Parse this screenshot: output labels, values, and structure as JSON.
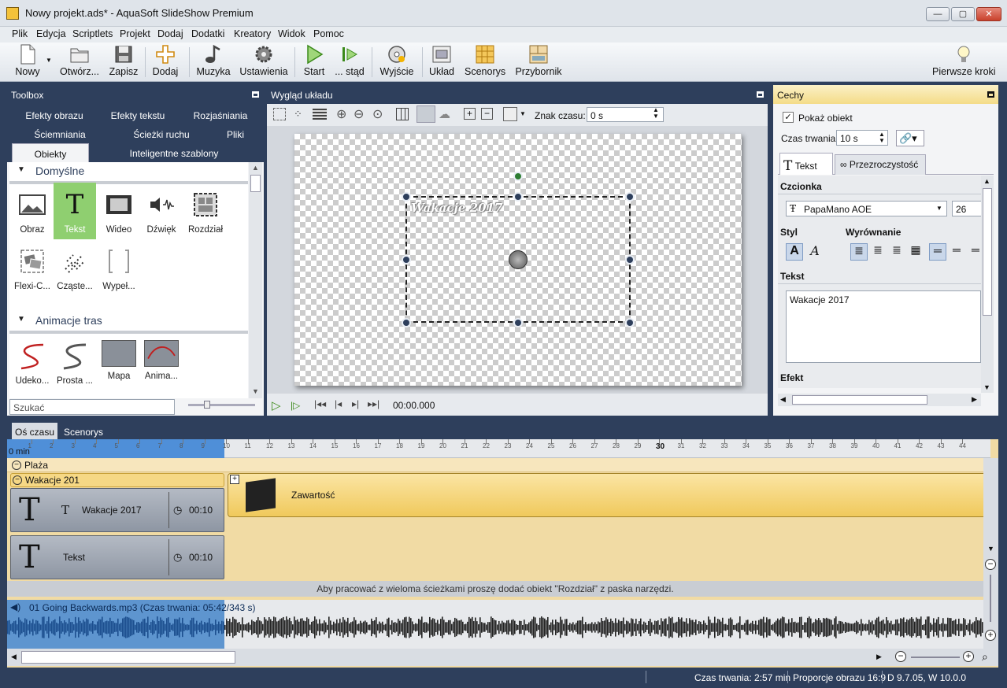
{
  "window": {
    "title": "Nowy projekt.ads* - AquaSoft SlideShow Premium",
    "min": "—",
    "max": "▢",
    "close": "✕"
  },
  "menu": [
    "Plik",
    "Edycja",
    "Scriptlets",
    "Projekt",
    "Dodaj",
    "Dodatki",
    "Kreatory",
    "Widok",
    "Pomoc"
  ],
  "toolbar": {
    "nowy": "Nowy",
    "otworz": "Otwórz...",
    "zapisz": "Zapisz",
    "dodaj": "Dodaj",
    "muzyka": "Muzyka",
    "ustawienia": "Ustawienia",
    "start": "Start",
    "stad": "... stąd",
    "wyjscie": "Wyjście",
    "uklad": "Układ",
    "scenorys": "Scenorys",
    "przybornik": "Przybornik",
    "pierwsze_kroki": "Pierwsze kroki"
  },
  "toolbox": {
    "title": "Toolbox",
    "tabs_row1": [
      "Efekty obrazu",
      "Efekty tekstu",
      "Rozjaśniania"
    ],
    "tabs_row2": [
      "Ściemniania",
      "Ścieżki ruchu",
      "Pliki"
    ],
    "tabs_row3": [
      "Obiekty",
      "Inteligentne szablony"
    ],
    "section_default": "Domyślne",
    "items_default": [
      "Obraz",
      "Tekst",
      "Wideo",
      "Dźwięk",
      "Rozdział",
      "Flexi-C...",
      "Cząste...",
      "Wypeł..."
    ],
    "section_anim": "Animacje tras",
    "items_anim": [
      "Udeko...",
      "Prosta ...",
      "Mapa",
      "Anima..."
    ],
    "search_placeholder": "Szukać",
    "search_value": "Szukać"
  },
  "layout": {
    "title": "Wygląd układu",
    "znak_czasu_label": "Znak czasu:",
    "znak_czasu_value": "0 s",
    "canvas_text": "Wakacje 2017",
    "playback_time": "00:00.000"
  },
  "props": {
    "title": "Cechy",
    "show_object": "Pokaż obiekt",
    "duration_label": "Czas trwania:",
    "duration_value": "10 s",
    "tab_text": "Tekst",
    "tab_transparency": "Przezroczystość",
    "font_section": "Czcionka",
    "font_name": "PapaMano AOE",
    "font_size": "26",
    "style_label": "Styl",
    "align_label": "Wyrównanie",
    "text_label": "Tekst",
    "text_value": "Wakacje 2017",
    "effect_label": "Efekt"
  },
  "bottom_tabs": [
    "Oś czasu",
    "Scenorys"
  ],
  "timeline": {
    "ruler_start": "0 min",
    "ruler_ticks": [
      "1",
      "2",
      "3",
      "4",
      "5",
      "6",
      "7",
      "8",
      "9",
      "10",
      "11",
      "12",
      "13",
      "14",
      "15",
      "16",
      "17",
      "18",
      "19",
      "20",
      "21",
      "22",
      "23",
      "24",
      "25",
      "26",
      "27",
      "28",
      "29",
      "30",
      "31",
      "32",
      "33",
      "34",
      "35",
      "36",
      "37",
      "38",
      "39",
      "40",
      "41",
      "42",
      "43",
      "44"
    ],
    "track_plaza": "Plaża",
    "group_label": "Wakacje 201",
    "item1_label": "Wakacje 2017",
    "item1_time": "00:10",
    "item2_label": "Tekst",
    "item2_time": "00:10",
    "content_label": "Zawartość",
    "hint": "Aby pracować z wieloma ścieżkami proszę dodać obiekt \"Rozdział\" z paska narzędzi.",
    "audio_label": "01 Going Backwards.mp3 (Czas trwania: 05:42/343 s)"
  },
  "status": {
    "duration": "Czas trwania: 2:57 min",
    "ratio": "Proporcje obrazu 16:9",
    "version": "D 9.7.05, W 10.0.0"
  }
}
